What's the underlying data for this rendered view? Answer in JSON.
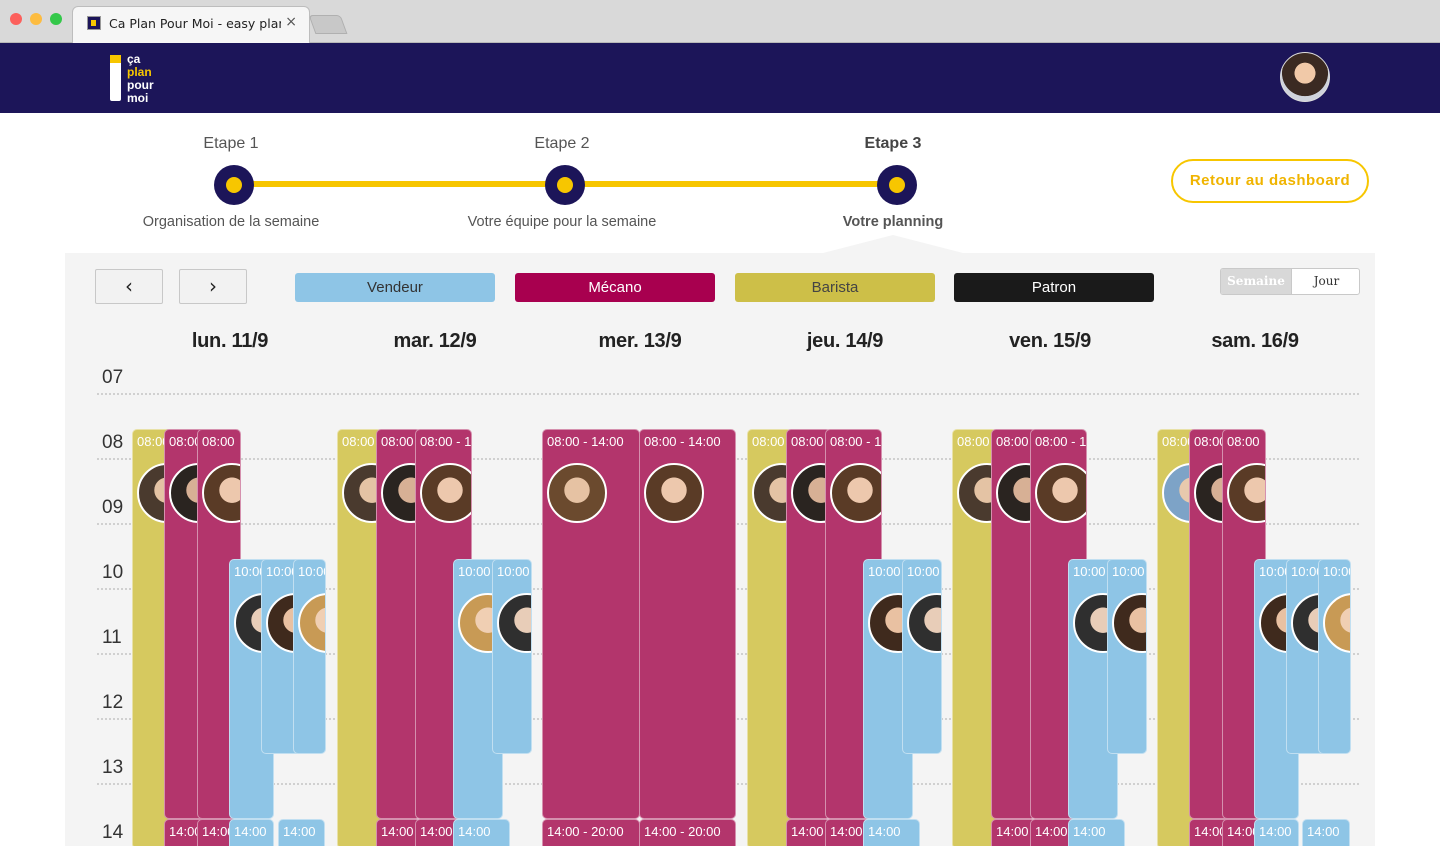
{
  "browser": {
    "tab_title": "Ca Plan Pour Moi - easy planning",
    "tab_close": "×"
  },
  "logo": {
    "lines": [
      "ça",
      "plan",
      "pour",
      "moi"
    ]
  },
  "stepper": {
    "steps": [
      {
        "label": "Etape 1",
        "sublabel": "Organisation de la semaine",
        "active": false
      },
      {
        "label": "Etape 2",
        "sublabel": "Votre équipe pour la semaine",
        "active": false
      },
      {
        "label": "Etape 3",
        "sublabel": "Votre planning",
        "active": true
      }
    ]
  },
  "dashboard_button": "Retour au dashboard",
  "nav": {
    "prev": "‹",
    "next": "›"
  },
  "roles": [
    {
      "label": "Vendeur",
      "color": "#8ec5e6",
      "text_color": "#333333"
    },
    {
      "label": "Mécano",
      "color": "#b3356c",
      "text_color": "#ffffff"
    },
    {
      "label": "Barista",
      "color": "#d6c95f",
      "text_color": "#444444"
    },
    {
      "label": "Patron",
      "color": "#1a1a1a",
      "text_color": "#ffffff"
    }
  ],
  "view_toggle": {
    "options": [
      "Semaine",
      "Jour"
    ],
    "selected": "Semaine"
  },
  "days": [
    "lun. 11/9",
    "mar. 12/9",
    "mer. 13/9",
    "jeu. 14/9",
    "ven. 15/9",
    "sam. 16/9"
  ],
  "hours": [
    "07",
    "08",
    "09",
    "10",
    "11",
    "12",
    "13",
    "14"
  ],
  "shift_texts": {
    "s0808": "08:00",
    "s08a": "08:00 - 14:00",
    "s1000": "10:00",
    "s1400": "14:00",
    "s14b": "14:00 - 20:00"
  },
  "colors": {
    "brand": "#1c1559",
    "accent": "#f7c600"
  }
}
